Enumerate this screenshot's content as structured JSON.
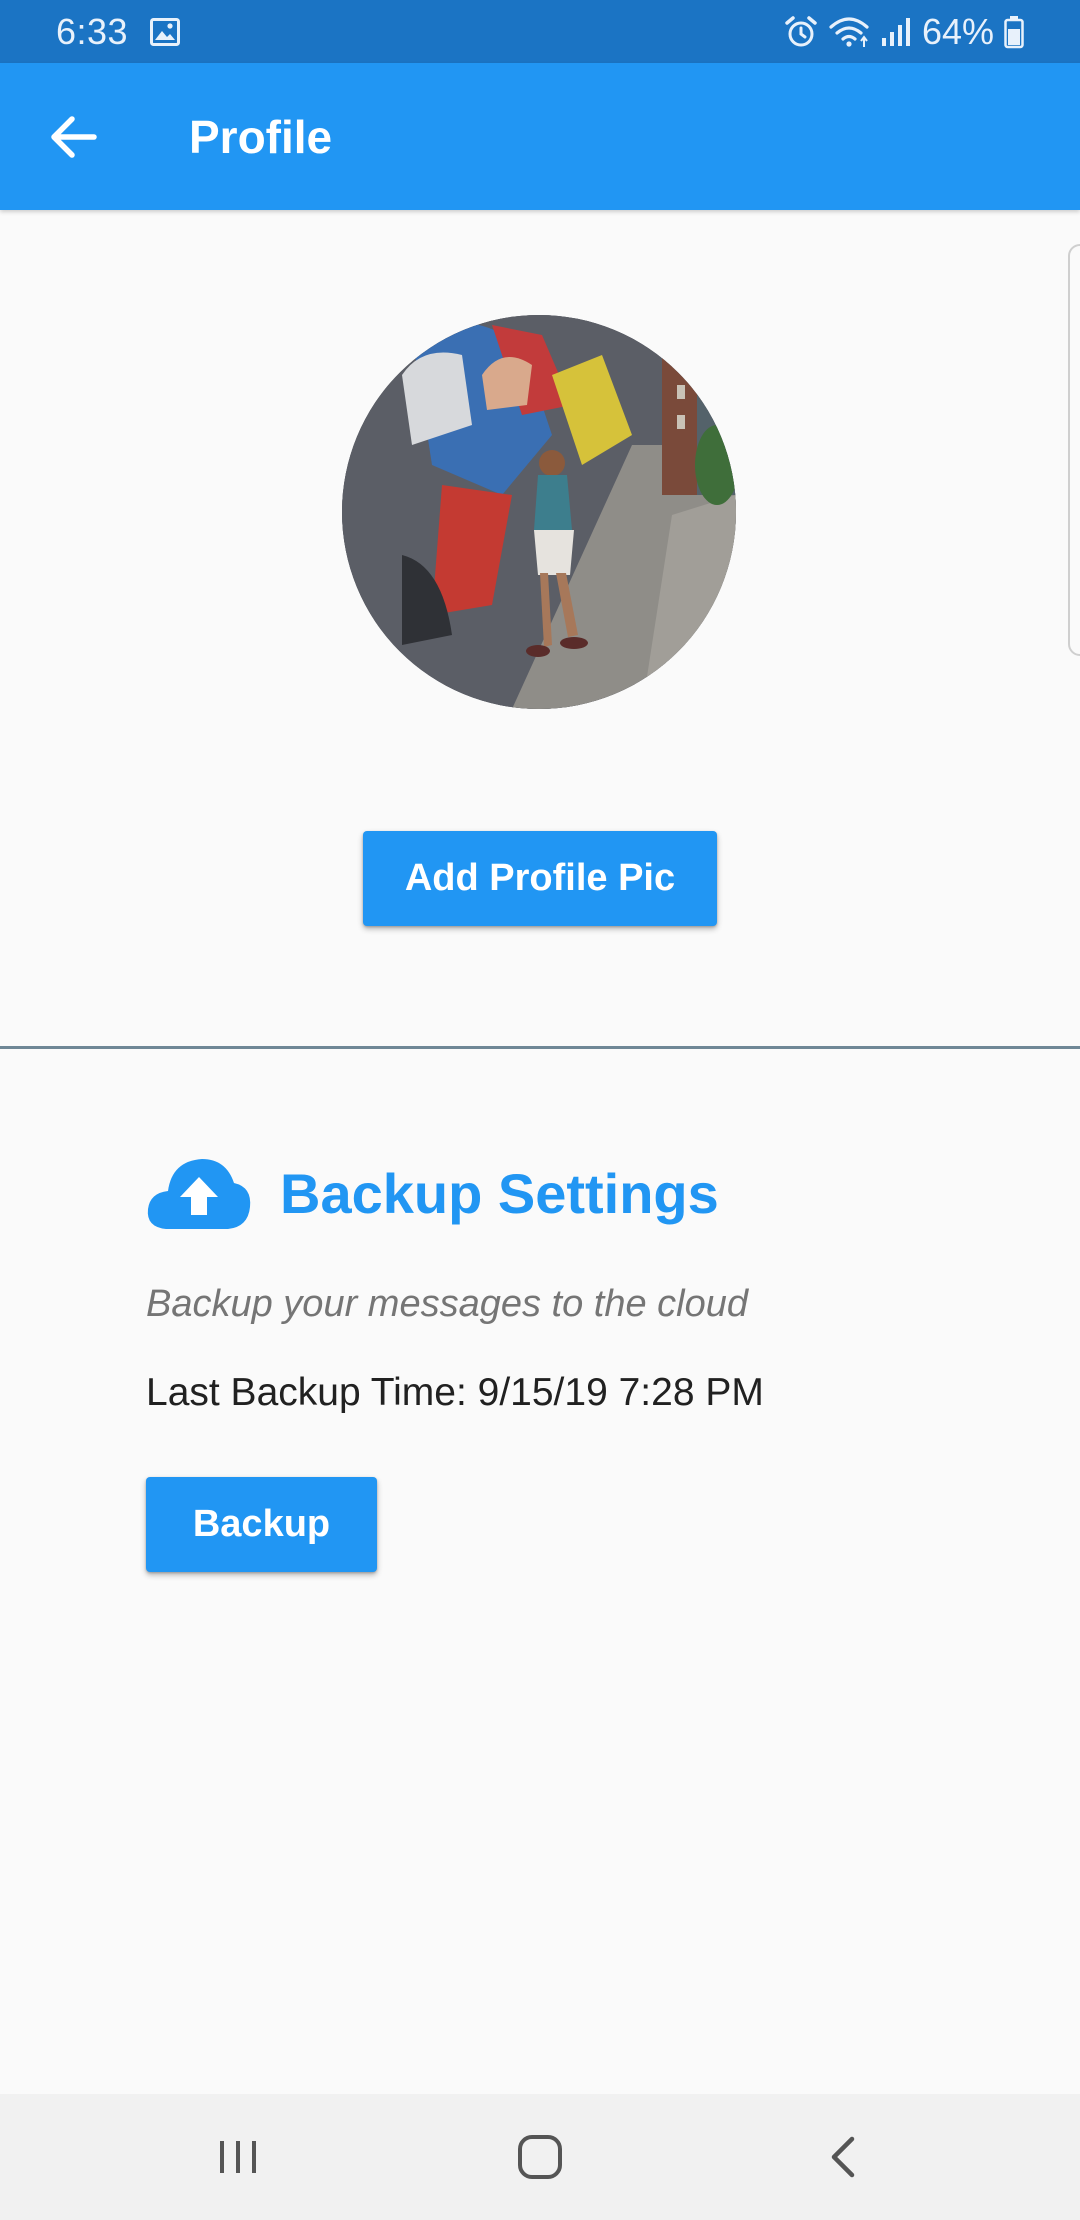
{
  "status_bar": {
    "time": "6:33",
    "battery": "64%",
    "icons": [
      "image-icon",
      "alarm-icon",
      "wifi-icon",
      "signal-icon",
      "battery-icon"
    ]
  },
  "app_bar": {
    "title": "Profile",
    "back_icon": "arrow-left-icon"
  },
  "profile": {
    "add_pic_label": "Add Profile Pic"
  },
  "backup": {
    "title": "Backup Settings",
    "icon": "cloud-upload-icon",
    "subtitle": "Backup your messages to the cloud",
    "last_backup": "Last Backup Time: 9/15/19 7:28 PM",
    "button_label": "Backup"
  },
  "nav_bar": {
    "items": [
      "recents-icon",
      "home-icon",
      "back-icon"
    ]
  },
  "colors": {
    "primary": "#2196f3",
    "status_bar": "#1b74c4",
    "background": "#fafafa",
    "divider": "#6f8796"
  }
}
